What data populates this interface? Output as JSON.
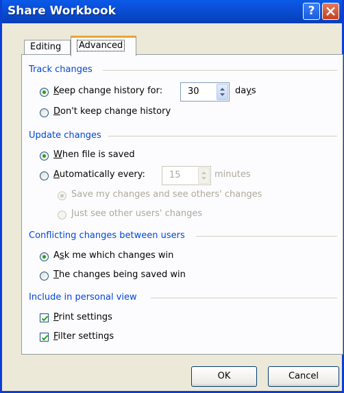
{
  "window": {
    "title": "Share Workbook"
  },
  "tabs": [
    {
      "label": "Editing"
    },
    {
      "label": "Advanced"
    }
  ],
  "track": {
    "heading": "Track changes",
    "keep_label_pre": "",
    "keep_label_ul": "K",
    "keep_label_post": "eep change history for:",
    "keep_days": "30",
    "days_pre": "da",
    "days_ul": "y",
    "days_post": "s",
    "dont_ul": "D",
    "dont_post": "on't keep change history"
  },
  "update": {
    "heading": "Update changes",
    "when_ul": "W",
    "when_post": "hen file is saved",
    "auto_ul": "A",
    "auto_post": "utomatically every:",
    "minutes_value": "15",
    "minutes_label": "minutes",
    "save_see": "Save my changes and see others' changes",
    "just_see": "Just see other users' changes"
  },
  "conflict": {
    "heading": "Conflicting changes between users",
    "ask_pre": "A",
    "ask_ul": "s",
    "ask_post": "k me which changes win",
    "saved_ul": "T",
    "saved_post": "he changes being saved win"
  },
  "personal": {
    "heading": "Include in personal view",
    "print_ul": "P",
    "print_post": "rint settings",
    "filter_ul": "F",
    "filter_post": "ilter settings"
  },
  "buttons": {
    "ok": "OK",
    "cancel": "Cancel"
  }
}
